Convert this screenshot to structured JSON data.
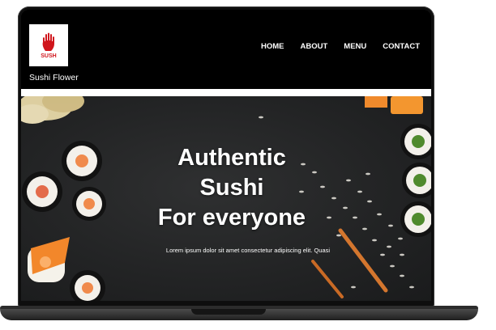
{
  "site": {
    "logo_text": "SUSH",
    "brand_name": "Sushi Flower",
    "logo_icon": "red-hand-icon",
    "accent_color": "#d0151c"
  },
  "nav": {
    "items": [
      {
        "label": "HOME"
      },
      {
        "label": "ABOUT"
      },
      {
        "label": "MENU"
      },
      {
        "label": "CONTACT"
      }
    ]
  },
  "hero": {
    "heading_lines": [
      "Authentic",
      "Sushi",
      "For everyone"
    ],
    "subtext": "Lorem ipsum dolor sit amet consectetur adipiscing elit. Quasi"
  }
}
